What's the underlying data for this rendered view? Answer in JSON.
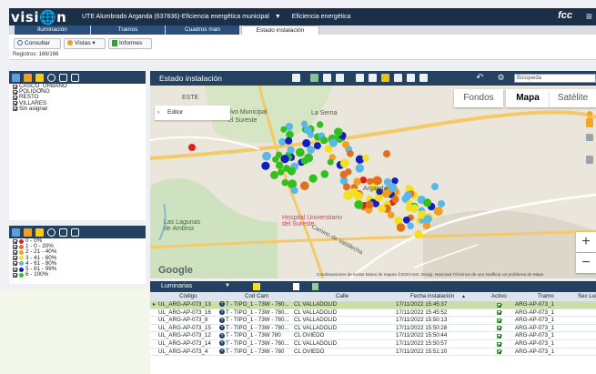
{
  "header": {
    "logo": "visi🌐n",
    "organization": "UTE Alumbrado Arganda (637836)-Eficiencia energética municipal",
    "module": "Eficiencia energética",
    "brand": "fcc"
  },
  "tabs": [
    {
      "label": "Iluminación"
    },
    {
      "label": "Tramos"
    },
    {
      "label": "Cuadros man"
    },
    {
      "label": "Estado instalación",
      "active": true
    }
  ],
  "toolbar": {
    "consultar": "Consultar",
    "vistas": "Vistas",
    "informes": "Informes",
    "registros": "Registros: 166/166"
  },
  "layers_panel": {
    "items": [
      "CASCO_URBANO",
      "POLIGONO",
      "RESTO",
      "VILLARES",
      "Sin asignar"
    ]
  },
  "legend_panel": {
    "items": [
      {
        "label": "0 - 0%",
        "color": "#e02020"
      },
      {
        "label": "1 - 0 - 20%",
        "color": "#e07020"
      },
      {
        "label": "2 - 21 - 40%",
        "color": "#f0a020"
      },
      {
        "label": "3 - 41 - 60%",
        "color": "#f5e020"
      },
      {
        "label": "4 - 61 - 80%",
        "color": "#5ab8e8"
      },
      {
        "label": "5 - 81 - 99%",
        "color": "#1020c0"
      },
      {
        "label": "6 - 100%",
        "color": "#30c020"
      }
    ]
  },
  "map_panel": {
    "title": "Estado instalación",
    "search_placeholder": "Búsqueda",
    "map_types": [
      "Fondos",
      "Mapa",
      "Satélite"
    ],
    "editor": "Editor",
    "labels": {
      "este": "ESTE",
      "parque": "tivo Municipal",
      "sureste": "el Sureste",
      "serna": "La Serna",
      "lagunas": "Las Lagunas\nde Ambroz",
      "hospital": "Hospital Universitario\ndel Sureste",
      "arganda": "Arganda",
      "camino": "Camino de Valdilecha"
    },
    "attribution": "Combinaciones de teclas   Datos de mapas ©2023 Inst. Geogr. Nacional   Términos de uso   Notificar un problema de Maps",
    "google": "Google"
  },
  "table_panel": {
    "title": "Luminarias",
    "columns": [
      "Código",
      "Cod Cam",
      "Calle",
      "Fecha instalación",
      "Activo",
      "Tramo",
      "Sec Lum"
    ],
    "rows": [
      {
        "codigo": "UL_ARG-AP-073_13",
        "codcam": "T - TIPO_1 - 73W - 780...",
        "calle": "CL VALLADOLID",
        "fecha": "17/11/2022 15:45:37",
        "tramo": "ARG-AP-073_1"
      },
      {
        "codigo": "UL_ARG-AP-073_16",
        "codcam": "T - TIPO_1 - 73W - 780...",
        "calle": "CL VALLADOLID",
        "fecha": "17/11/2022 15:45:52",
        "tramo": "ARG-AP-073_1"
      },
      {
        "codigo": "UL_ARG-AP-073_8",
        "codcam": "T - TIPO_1 - 73W - 780...",
        "calle": "CL VALLADOLID",
        "fecha": "17/11/2022 15:50:13",
        "tramo": "ARG-AP-073_1"
      },
      {
        "codigo": "UL_ARG-AP-073_15",
        "codcam": "T - TIPO_1 - 73W - 780...",
        "calle": "CL VALLADOLID",
        "fecha": "17/11/2022 15:50:28",
        "tramo": "ARG-AP-073_1"
      },
      {
        "codigo": "UL_ARG-AP-073_12",
        "codcam": "T - TIPO_1 - 73W   780",
        "calle": "CL OVIEDO",
        "fecha": "17/11/2022 15:50:44",
        "tramo": "ARG-AP-073_1"
      },
      {
        "codigo": "UL_ARG-AP-073_14",
        "codcam": "T - TIPO_1 - 73W - 780...",
        "calle": "CL VALLADOLID",
        "fecha": "17/11/2022 15:50:57",
        "tramo": "ARG-AP-073_1"
      },
      {
        "codigo": "UL_ARG-AP-073_4",
        "codcam": "T - TIPO_1 - 73W - 780",
        "calle": "CL OVIEDO",
        "fecha": "17/11/2022 15:51:10",
        "tramo": "ARG-AP-073_1"
      }
    ]
  },
  "colors": {
    "header": "#1b2f47",
    "panel": "#24415f",
    "selected_row": "#c8e0a8"
  }
}
